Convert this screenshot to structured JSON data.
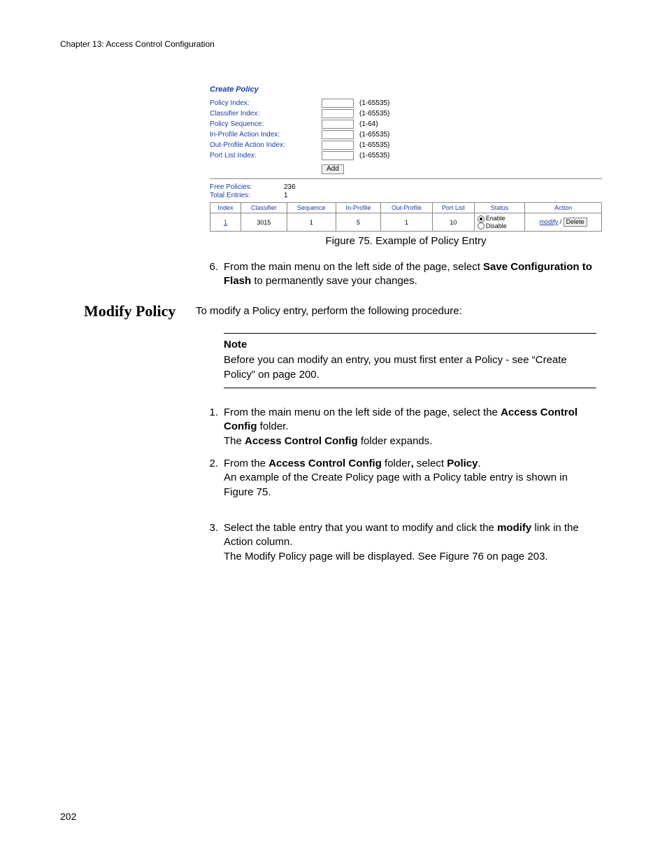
{
  "header": {
    "chapter": "Chapter 13: Access Control Configuration"
  },
  "page_number": "202",
  "figure": {
    "title": "Create Policy",
    "fields": {
      "policy_index": {
        "label": "Policy Index:",
        "hint": "(1-65535)"
      },
      "classifier_index": {
        "label": "Classifier Index:",
        "hint": "(1-65535)"
      },
      "policy_sequence": {
        "label": "Policy Sequence:",
        "hint": "(1-64)"
      },
      "in_profile_action_index": {
        "label": "In-Profile Action Index:",
        "hint": "(1-65535)"
      },
      "out_profile_action_index": {
        "label": "Out-Profile Action Index:",
        "hint": "(1-65535)"
      },
      "port_list_index": {
        "label": "Port List Index:",
        "hint": "(1-65535)"
      }
    },
    "add_button": "Add",
    "stats": {
      "free_policies": {
        "label": "Free Policies:",
        "value": "236"
      },
      "total_entries": {
        "label": "Total Entries:",
        "value": "1"
      }
    },
    "table": {
      "headers": {
        "index": "Index",
        "classifier": "Classifier",
        "sequence": "Sequence",
        "in_profile": "In-Profile",
        "out_profile": "Out-Profile",
        "port_list": "Port List",
        "status": "Status",
        "action": "Action"
      },
      "row": {
        "index": "1",
        "classifier": "3015",
        "sequence": "1",
        "in_profile": "5",
        "out_profile": "1",
        "port_list": "10",
        "status_enable": "Enable",
        "status_disable": "Disable",
        "modify": "modify",
        "delete": "Delete"
      }
    },
    "caption": "Figure 75. Example of Policy Entry"
  },
  "section_heading": "Modify Policy",
  "step6": {
    "num": "6.",
    "part1": "From the main menu on the left side of the page, select ",
    "bold1": "Save Configuration to Flash",
    "part2": " to permanently save your changes."
  },
  "intro": "To modify a Policy entry, perform the following procedure:",
  "note": {
    "title": "Note",
    "body": "Before you can modify an entry, you must first enter a Policy - see “Create Policy” on page 200."
  },
  "step1": {
    "num": "1.",
    "part1": "From the main menu on the left side of the page, select the ",
    "bold1": "Access Control Config",
    "part2": " folder.",
    "line2a": "The ",
    "line2b": "Access Control Config",
    "line2c": " folder expands."
  },
  "step2": {
    "num": "2.",
    "part1": "From the ",
    "bold1": "Access Control Config",
    "part2": " folder",
    "bold_comma": ",",
    "part3": " select ",
    "bold2": "Policy",
    "part4": ".",
    "line2": "An example of the Create Policy page with a Policy table entry is shown in Figure 75."
  },
  "step3": {
    "num": "3.",
    "part1": "Select the table entry that you want to modify and click the ",
    "bold1": "modify",
    "part2": " link in the Action column.",
    "line2": "The Modify Policy page will be displayed. See Figure 76 on page 203."
  }
}
